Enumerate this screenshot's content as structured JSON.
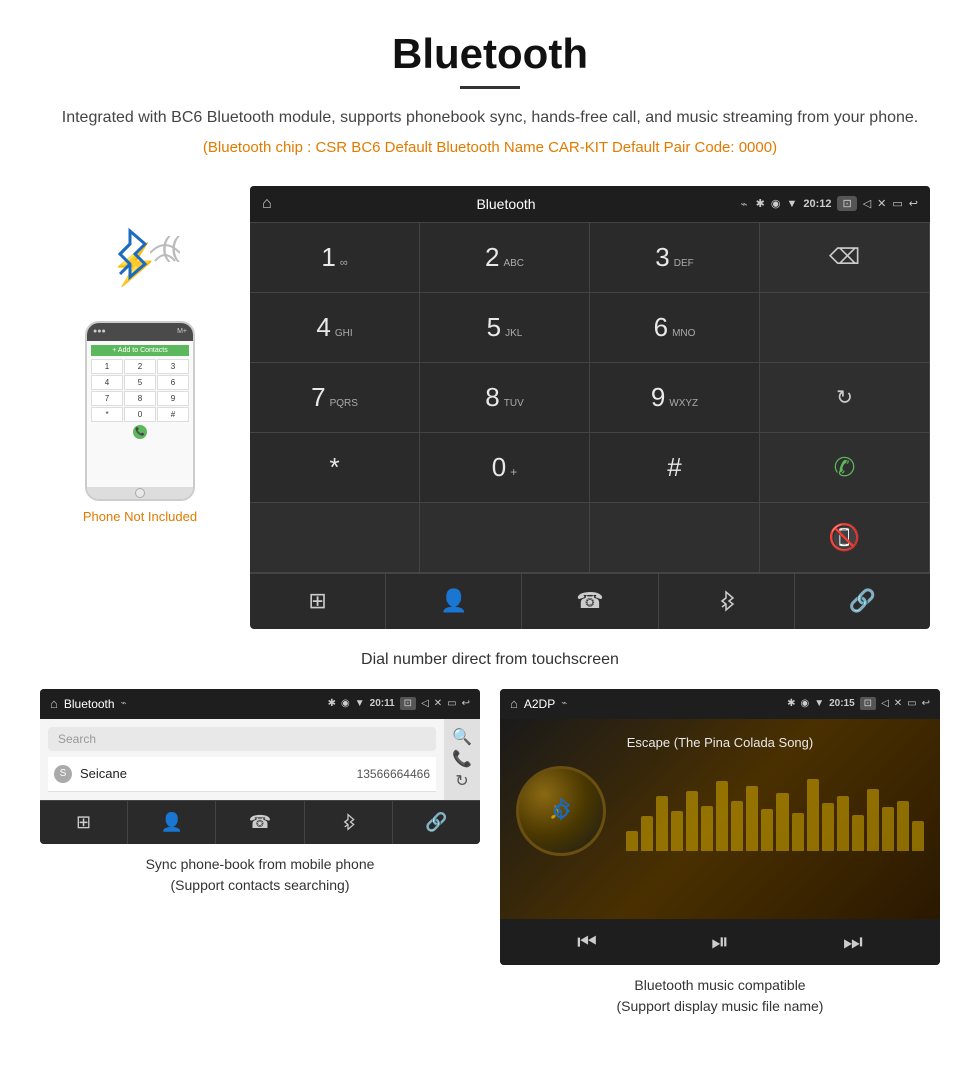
{
  "header": {
    "title": "Bluetooth",
    "divider": true,
    "description": "Integrated with BC6 Bluetooth module, supports phonebook sync, hands-free call, and music streaming from your phone.",
    "specs": "(Bluetooth chip : CSR BC6    Default Bluetooth Name CAR-KIT    Default Pair Code: 0000)"
  },
  "dial_screen": {
    "statusbar": {
      "title": "Bluetooth",
      "usb_icon": "⌁",
      "time": "20:12",
      "icons": [
        "✱",
        "◉",
        "▼",
        "⊡",
        "◁◁",
        "☒",
        "▭",
        "↩"
      ]
    },
    "keys": [
      {
        "num": "1",
        "sub": "∞",
        "row": 0,
        "col": 0
      },
      {
        "num": "2",
        "sub": "ABC",
        "row": 0,
        "col": 1
      },
      {
        "num": "3",
        "sub": "DEF",
        "row": 0,
        "col": 2
      },
      {
        "num": "4",
        "sub": "GHI",
        "row": 1,
        "col": 0
      },
      {
        "num": "5",
        "sub": "JKL",
        "row": 1,
        "col": 1
      },
      {
        "num": "6",
        "sub": "MNO",
        "row": 1,
        "col": 2
      },
      {
        "num": "7",
        "sub": "PQRS",
        "row": 2,
        "col": 0
      },
      {
        "num": "8",
        "sub": "TUV",
        "row": 2,
        "col": 1
      },
      {
        "num": "9",
        "sub": "WXYZ",
        "row": 2,
        "col": 2
      },
      {
        "num": "*",
        "sub": "",
        "row": 3,
        "col": 0
      },
      {
        "num": "0",
        "sub": "+",
        "row": 3,
        "col": 1
      },
      {
        "num": "#",
        "sub": "",
        "row": 3,
        "col": 2
      }
    ],
    "bottom_nav": [
      "⊞",
      "👤",
      "☎",
      "✱",
      "🔗"
    ],
    "caption": "Dial number direct from touchscreen"
  },
  "phonebook_screen": {
    "statusbar": {
      "title": "Bluetooth",
      "usb_icon": "⌁",
      "time": "20:11"
    },
    "search_placeholder": "Search",
    "contacts": [
      {
        "letter": "S",
        "name": "Seicane",
        "number": "13566664466"
      }
    ],
    "bottom_nav": [
      "⊞",
      "👤",
      "☎",
      "✱",
      "🔗"
    ],
    "caption_line1": "Sync phone-book from mobile phone",
    "caption_line2": "(Support contacts searching)"
  },
  "music_screen": {
    "statusbar": {
      "title": "A2DP",
      "usb_icon": "⌁",
      "time": "20:15"
    },
    "song_title": "Escape (The Pina Colada Song)",
    "waveform_bars": [
      20,
      35,
      55,
      40,
      60,
      45,
      70,
      50,
      65,
      42,
      58,
      38,
      72,
      48,
      55,
      36,
      62,
      44,
      50,
      30
    ],
    "controls": [
      "⏮",
      "⏯",
      "⏭"
    ],
    "caption_line1": "Bluetooth music compatible",
    "caption_line2": "(Support display music file name)"
  },
  "phone_side": {
    "not_included": "Phone Not Included"
  }
}
